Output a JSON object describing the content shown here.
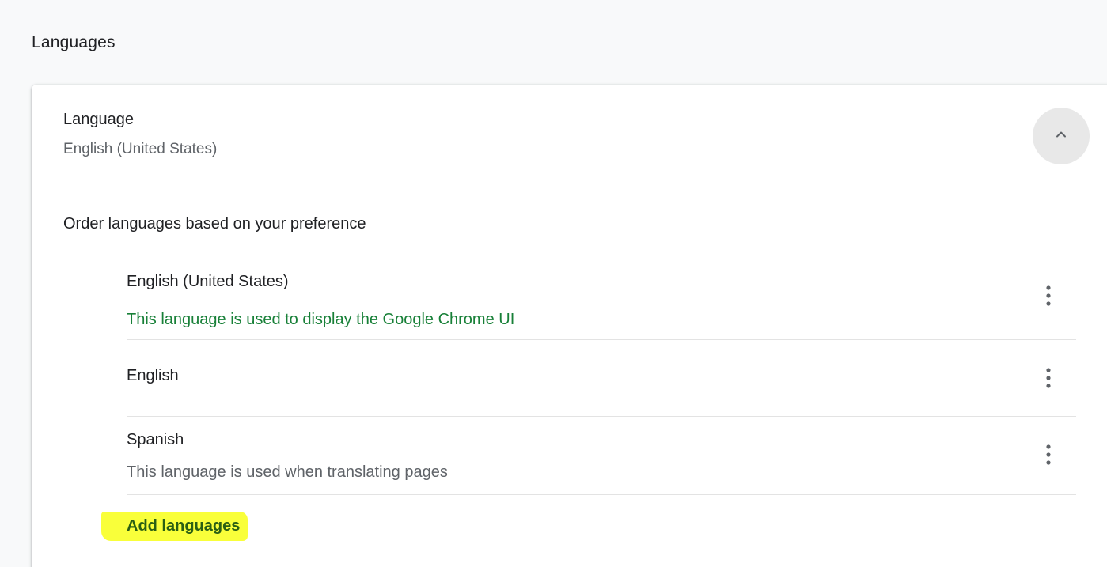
{
  "section": {
    "title": "Languages"
  },
  "language_header": {
    "title": "Language",
    "current": "English (United States)"
  },
  "order_label": "Order languages based on your preference",
  "languages": [
    {
      "name": "English (United States)",
      "note": "This language is used to display the Google Chrome UI"
    },
    {
      "name": "English",
      "note": ""
    },
    {
      "name": "Spanish",
      "note": "This language is used when translating pages"
    }
  ],
  "add_languages_label": "Add languages",
  "colors": {
    "ui_note": "#188038",
    "highlight": "#f9ff3a",
    "link": "#2a5f14"
  },
  "icons": {
    "collapse": "chevron-up-icon",
    "more": "more-vert-icon"
  }
}
